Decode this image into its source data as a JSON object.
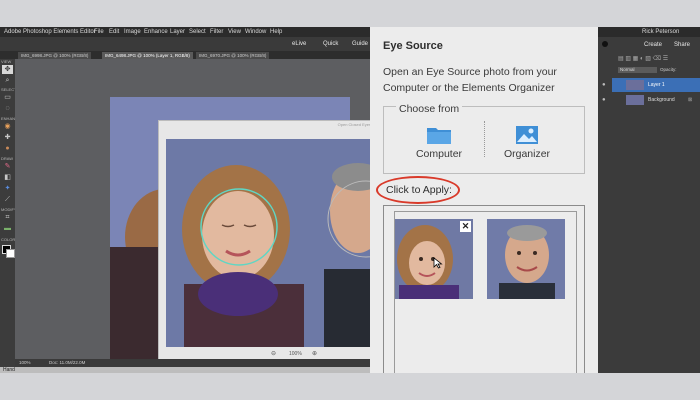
{
  "app": {
    "title": "Adobe Photoshop Elements Editor",
    "menu": [
      "File",
      "Edit",
      "Image",
      "Enhance",
      "Layer",
      "Select",
      "Filter",
      "View",
      "Window",
      "Help"
    ],
    "user_name": "Rick Peterson"
  },
  "modes": [
    "eLive",
    "Quick",
    "Guide"
  ],
  "doc_tabs": [
    "IMG_6998.JPG @ 100% (RGB/8)",
    "IMG_6498.JPG @ 100% (Layer 1, RGB/8)",
    "IMG_6970.JPG @ 100% (RGB/8)"
  ],
  "tool_labels": [
    "VIEW",
    "SELECT",
    "ENHANCE",
    "DRAW",
    "MODIFY",
    "COLOR"
  ],
  "edit_window_title": "Open Closed Eyes",
  "edit_zoom": "100%",
  "status": {
    "zoom": "100%",
    "doc": "Doc: 11.0M/22.0M",
    "tool": "Hand"
  },
  "right_panel": {
    "create": "Create",
    "share": "Share",
    "blend_mode": "Normal",
    "opacity_label": "Opacity:",
    "layers": [
      "Layer 1",
      "Background"
    ]
  },
  "eye_source": {
    "title": "Eye Source",
    "description": "Open an Eye Source photo from your Computer or the Elements Organizer",
    "choose_from": "Choose from",
    "computer": "Computer",
    "organizer": "Organizer",
    "click_to_apply": "Click to Apply:"
  },
  "colors": {
    "accent_ring": "#d93a2a",
    "selection_circle": "#5fd6c4",
    "folder_blue": "#3f8fd6",
    "layer_selected": "#3b6fb6"
  }
}
